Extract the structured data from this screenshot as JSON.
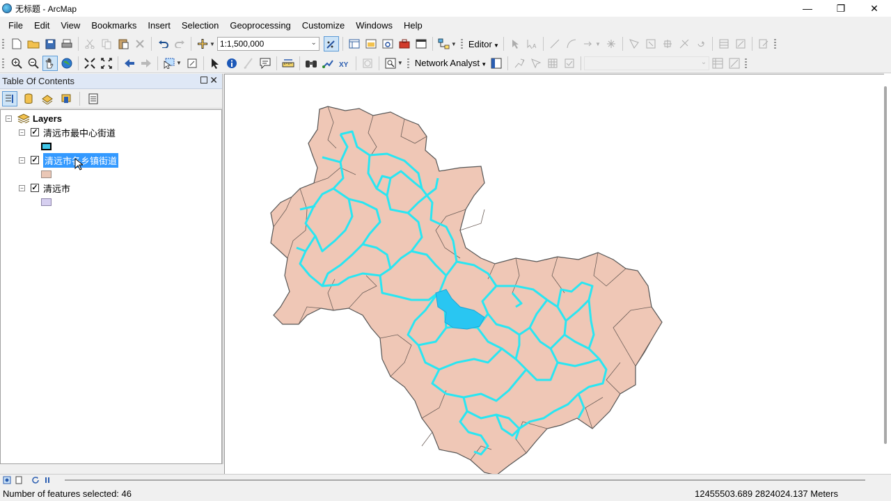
{
  "window": {
    "title": "无标题 - ArcMap",
    "controls": [
      "minimize-icon",
      "maximize-icon",
      "close-icon"
    ]
  },
  "menubar": {
    "items": [
      "File",
      "Edit",
      "View",
      "Bookmarks",
      "Insert",
      "Selection",
      "Geoprocessing",
      "Customize",
      "Windows",
      "Help"
    ]
  },
  "toolbar_standard": {
    "scale_value": "1:1,500,000",
    "editor_label": "Editor"
  },
  "toolbar_tools": {
    "network_analyst_label": "Network Analyst"
  },
  "toc": {
    "title": "Table Of Contents",
    "root_label": "Layers",
    "layers": [
      {
        "name": "清远市最中心街道",
        "checked": true,
        "swatch_fill": "#3fc6e8",
        "swatch_border": "#000000"
      },
      {
        "name": "清远市各乡镇街道",
        "checked": true,
        "selected": true,
        "swatch_fill": "#eac7b6",
        "swatch_border": "#9c8c84"
      },
      {
        "name": "清远市",
        "checked": true,
        "swatch_fill": "#d6cff0",
        "swatch_border": "#8c84a8"
      }
    ]
  },
  "map": {
    "background": "#ffffff",
    "region_fill": "#efc7b6",
    "region_stroke": "#555555",
    "street_stroke": "#29e6f2",
    "center_fill": "#29c6f2"
  },
  "status": {
    "selection_text": "Number of features selected: 46",
    "coordinates": "12455503.689  2824024.137 Meters"
  }
}
